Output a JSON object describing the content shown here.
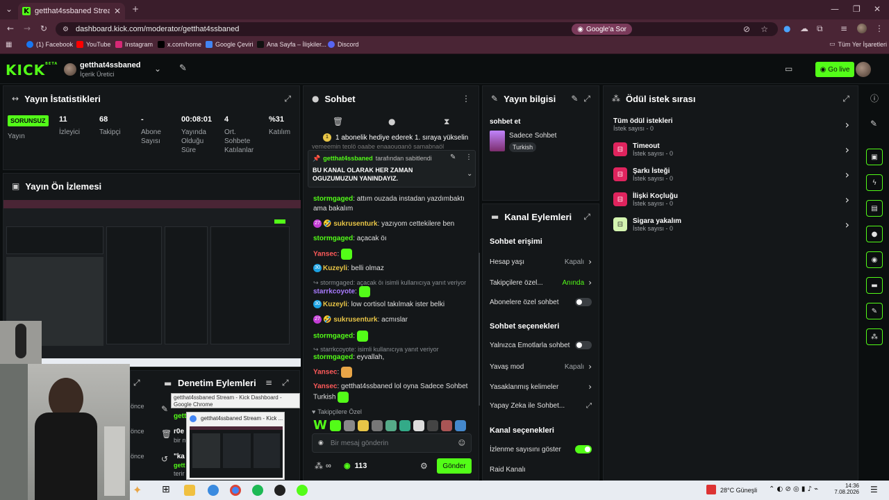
{
  "browser": {
    "tab_title": "getthat4ssbaned Stream - Kick",
    "url": "dashboard.kick.com/moderator/getthat4ssbaned",
    "google_sor": "Google'a Sor",
    "bookmarks": [
      "(1) Facebook",
      "YouTube",
      "Instagram",
      "x.com/home",
      "Google Çeviri",
      "Ana Sayfa – İlişkiler...",
      "Discord"
    ],
    "all_bookmarks": "Tüm Yer İşaretleri"
  },
  "kick": {
    "logo": "KICK",
    "logo_beta": "BETA",
    "channel_name": "getthat4ssbaned",
    "channel_role": "İçerik Üretici",
    "go_live": "Go live"
  },
  "stats": {
    "title": "Yayın İstatistikleri",
    "status_badge": "SORUNSUZ",
    "status_label": "Yayın",
    "items": [
      {
        "value": "11",
        "label": "İzleyici"
      },
      {
        "value": "68",
        "label": "Takipçi"
      },
      {
        "value": "-",
        "label": "Abone Sayısı"
      },
      {
        "value": "00:08:01",
        "label": "Yayında Olduğu Süre"
      },
      {
        "value": "4",
        "label": "Ort. Sohbete Katılanlar"
      },
      {
        "value": "%31",
        "label": "Katılım"
      }
    ]
  },
  "preview": {
    "title": "Yayın Ön İzlemesi"
  },
  "mod": {
    "title": "Denetim Eylemleri",
    "times": [
      "önce",
      "önce",
      "önce"
    ],
    "names": [
      "gett",
      "r0e",
      "\"ka"
    ],
    "subs": [
      "",
      "bir n",
      "gett"
    ],
    "tail": "terir"
  },
  "chat": {
    "title": "Sohbet",
    "gift_banner": "1 abonelik hediye ederek 1. sıraya yükselin",
    "cut_line": "yemeemin teplö oaabe enaaouganö samabnaöl",
    "pinned_by": "getthat4ssbaned",
    "pinned_suffix": "tarafından sabitlendi",
    "pinned_text": "BU KANAL OLARAK HER ZAMAN OGUZUMUZUN YANINDAYIZ.",
    "messages": [
      {
        "user": "stormgaged",
        "text": "attım ouzada instadan yazdımbaktı ama bakalım"
      },
      {
        "user": "sukrusenturk",
        "level": "27",
        "text": "yazıyom cettekilere ben"
      },
      {
        "user": "stormgaged",
        "text": "açacak öı"
      },
      {
        "user": "Yansec",
        "text": ""
      },
      {
        "user": "Kuzeyli",
        "level": "30",
        "text": "belli olmaz"
      },
      {
        "reply": "stormgaged: açacak öı isimli kullanıcıya yanıt veriyor"
      },
      {
        "user": "starrkcoyote",
        "text": ""
      },
      {
        "user": "Kuzeyli",
        "level": "30",
        "text": "low cortisol takılmak ister belki"
      },
      {
        "user": "sukrusenturk",
        "level": "27",
        "text": "acmıslar"
      },
      {
        "user": "stormgaged",
        "text": ""
      },
      {
        "reply": "starrkcoyote:      isimli kullanıcıya yanıt veriyor"
      },
      {
        "user": "stormgaged",
        "text": "eyvallah,"
      },
      {
        "user": "Yansec",
        "text": ""
      },
      {
        "user": "Yansec",
        "text": "getthat4ssbaned lol oyna Sadece Sohbet Turkish"
      }
    ],
    "followers_only": "Takipçilere Özel",
    "input_placeholder": "Bir mesaj gönderin",
    "count": "113",
    "send": "Gönder",
    "infinity": "∞"
  },
  "stream_info": {
    "title": "Yayın bilgisi",
    "label": "sohbet et",
    "category": "Sadece Sohbet",
    "tag": "Turkish"
  },
  "channel_actions": {
    "title": "Kanal Eylemleri",
    "chat_access": "Sohbet erişimi",
    "account_age": "Hesap yaşı",
    "account_age_val": "Kapalı",
    "followers_only": "Takipçilere özel...",
    "followers_only_val": "Anında",
    "subs_only": "Abonelere özel sohbet",
    "chat_options": "Sohbet seçenekleri",
    "emotes_only": "Yalnızca Emotlarla sohbet",
    "slow_mode": "Yavaş mod",
    "slow_mode_val": "Kapalı",
    "banned_words": "Yasaklanmış kelimeler",
    "ai_chat": "Yapay Zeka ile Sohbet...",
    "channel_options": "Kanal seçenekleri",
    "show_views": "İzlenme sayısını göster",
    "raid": "Raid Kanalı"
  },
  "rewards": {
    "title": "Ödül istek sırası",
    "all": "Tüm ödül istekleri",
    "all_sub": "İstek sayısı - 0",
    "items": [
      {
        "name": "Timeout",
        "sub": "İstek sayısı - 0",
        "color": "#e0245e"
      },
      {
        "name": "Şarkı İsteği",
        "sub": "İstek sayısı - 0",
        "color": "#e0245e"
      },
      {
        "name": "İlişki Koçluğu",
        "sub": "İstek sayısı - 0",
        "color": "#e0245e"
      },
      {
        "name": "Sigara yakalım",
        "sub": "İstek sayısı - 0",
        "color": "#d4f5b0"
      }
    ]
  },
  "tooltip": {
    "chrome_title": "getthat4ssbaned Stream - Kick Dashboard - Google Chrome",
    "thumb_title": "getthat4ssbaned Stream - Kick ..."
  },
  "taskbar": {
    "weather": "28°C  Güneşli",
    "time": "14:36",
    "date": "7.08.2026"
  },
  "colors": {
    "accent": "#53fc18",
    "panel": "#141719",
    "bg": "#0b0e0f"
  }
}
